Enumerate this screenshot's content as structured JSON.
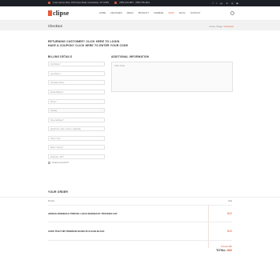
{
  "topbar": {
    "address": "Lorem ipsum dolor, 1234 Amet Road, Consectetur, NY 10001",
    "phone": "(555) 123-4567 · (555) 765-4321",
    "social": [
      "f",
      "t",
      "g+",
      "in",
      "◎",
      "▶"
    ]
  },
  "header": {
    "logo": "clipse",
    "nav": [
      "HOME",
      "FEATURES",
      "MENU",
      "PRODUCT",
      "SIDEBAR",
      "SHOP",
      "BLOG",
      "CONTACT"
    ],
    "active_nav": "SHOP"
  },
  "page": {
    "title": "Checkout",
    "breadcrumb_links": "Home / Page /",
    "breadcrumb_current": " Checkout"
  },
  "notices": {
    "login": "RETURNING CUSTOMER? CLICK HERE TO LOGIN",
    "coupon": "HAVE A COUPON? CLICK HERE TO ENTER YOUR CODE"
  },
  "billing": {
    "title": "BILLING DETAILS",
    "fields": [
      {
        "placeholder": "First Name *"
      },
      {
        "placeholder": "Last Name *"
      },
      {
        "placeholder": "Company Name"
      },
      {
        "placeholder": "Email Address *"
      },
      {
        "placeholder": "Phone *"
      },
      {
        "placeholder": "Country",
        "select": true
      },
      {
        "placeholder": "Street address *"
      },
      {
        "placeholder": "Apartment, suite, unit etc. (optional)"
      },
      {
        "placeholder": "Town / City *"
      },
      {
        "placeholder": "State / County *"
      },
      {
        "placeholder": "Postcode / ZIP *"
      }
    ],
    "create_account": "Create an account?"
  },
  "additional": {
    "title": "ADDITIONAL INFORMATION",
    "notes_placeholder": "Order Notes"
  },
  "order": {
    "title": "YOUR ORDER",
    "col_product": "Product",
    "col_total": "Total",
    "items": [
      {
        "name": "ADIDAS ORIGINALS TREFOIL LOGO SNAPBACK TRUCKER CAP",
        "price": "$40"
      },
      {
        "name": "ASOS TIGHT MF PREMIUM JEANS IN CLEAN BLACK",
        "price": "$40"
      }
    ],
    "subtotal": "Subtotal: $80",
    "total_label": "TOTAL:",
    "total_value": "$80"
  }
}
